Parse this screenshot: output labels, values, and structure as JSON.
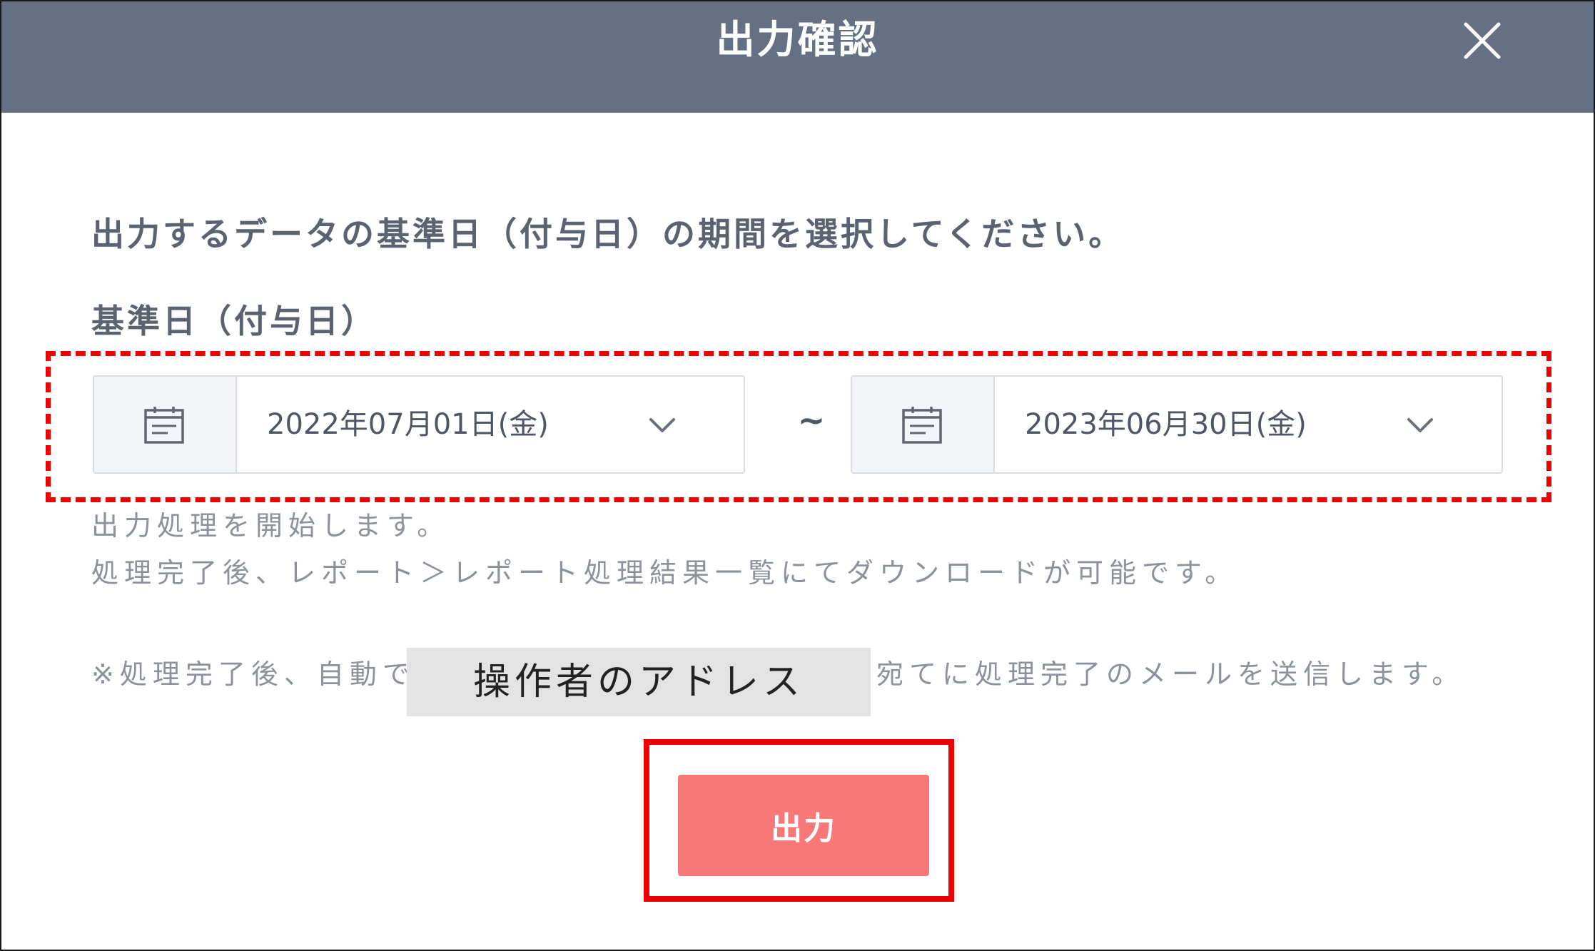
{
  "dialog": {
    "title": "出力確認",
    "close_icon": "close-icon"
  },
  "form": {
    "instruction": "出力するデータの基準日（付与日）の期間を選択してください。",
    "field_label": "基準日（付与日）",
    "date_start": {
      "value": "2022年07月01日(金)",
      "icon": "calendar-icon",
      "toggle_icon": "chevron-down-icon"
    },
    "separator": "~",
    "date_end": {
      "value": "2023年06月30日(金)",
      "icon": "calendar-icon",
      "toggle_icon": "chevron-down-icon"
    }
  },
  "notes": {
    "line1": "出力処理を開始します。",
    "line2": "処理完了後、レポート＞レポート処理結果一覧にてダウンロードが可能です。",
    "line3_before": "※処理完了後、自動で",
    "redacted_label": "操作者のアドレス",
    "line3_after": "宛てに処理完了のメールを送信します。"
  },
  "actions": {
    "output_label": "出力"
  },
  "colors": {
    "header_bg": "#647084",
    "button_bg": "#f87878",
    "annotation_red": "#ee0000",
    "text_primary": "#5b6270",
    "text_muted": "#8c929c"
  }
}
